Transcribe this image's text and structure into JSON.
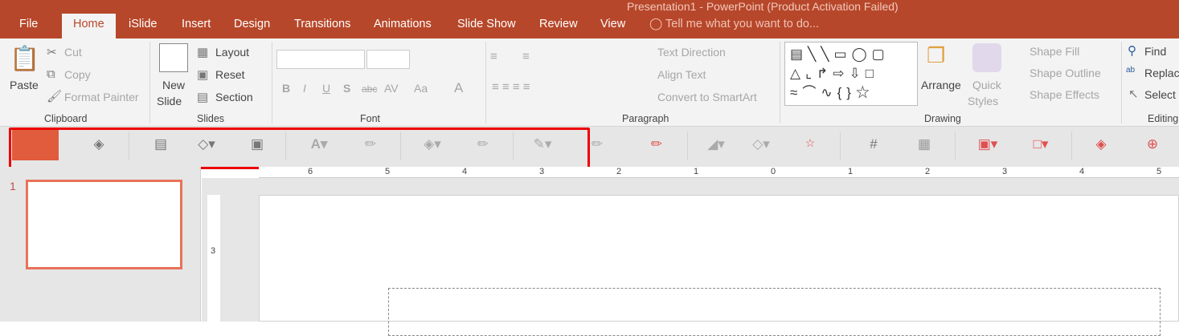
{
  "window": {
    "title": "Presentation1 - PowerPoint (Product Activation Failed)"
  },
  "tabs": [
    "File",
    "Home",
    "iSlide",
    "Insert",
    "Design",
    "Transitions",
    "Animations",
    "Slide Show",
    "Review",
    "View"
  ],
  "tell_me": "Tell me what you want to do...",
  "clipboard": {
    "paste": "Paste",
    "cut": "Cut",
    "copy": "Copy",
    "format_painter": "Format Painter",
    "label": "Clipboard"
  },
  "slides": {
    "new_slide": "New",
    "new_slide2": "Slide",
    "layout": "Layout",
    "reset": "Reset",
    "section": "Section",
    "label": "Slides"
  },
  "font": {
    "label": "Font",
    "bold": "B",
    "italic": "I",
    "underline": "U",
    "shadow": "S",
    "strike": "abc",
    "spacing": "AV",
    "case": "Aa",
    "color": "A"
  },
  "paragraph": {
    "label": "Paragraph",
    "text_direction": "Text Direction",
    "align_text": "Align Text",
    "smartart": "Convert to SmartArt"
  },
  "drawing": {
    "label": "Drawing",
    "arrange": "Arrange",
    "quick": "Quick",
    "styles": "Styles",
    "shape_fill": "Shape Fill",
    "shape_outline": "Shape Outline",
    "shape_effects": "Shape Effects"
  },
  "editing": {
    "label": "Editing",
    "find": "Find",
    "replace": "Replace",
    "select": "Select"
  },
  "ruler": {
    "h": [
      "6",
      "5",
      "4",
      "3",
      "2",
      "1",
      "0",
      "1",
      "2",
      "3",
      "4",
      "5"
    ],
    "v": [
      "3"
    ]
  },
  "thumbnail": {
    "number": "1"
  },
  "colors": {
    "accent": "#b7472a",
    "highlight": "#e00000"
  }
}
